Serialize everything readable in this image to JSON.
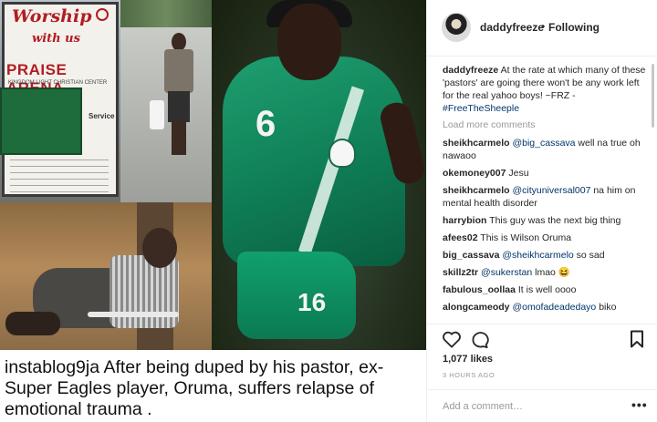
{
  "post": {
    "sign_texts": {
      "title": "Worship",
      "with": "with us",
      "name": "PRAISE ARENA",
      "sub": "KINGDOM LIGHT CHRISTIAN CENTER",
      "service": "Service"
    },
    "jersey_number": "6",
    "shorts_number": "16",
    "caption": {
      "user": "instablog9ja",
      "text": "After being duped by his pastor, ex-Super Eagles player, Oruma, suffers relapse of emotional trauma ."
    }
  },
  "header": {
    "username": "daddyfreeze",
    "separator": "•",
    "follow_status": "Following"
  },
  "post_body": {
    "username": "daddyfreeze",
    "text": "At the rate at which many of these 'pastors' are going there won't be any work left for the real yahoo boys! ~FRZ -",
    "hashtag": "#FreeTheSheeple"
  },
  "load_more": "Load more comments",
  "comments": [
    {
      "user": "sheikhcarmelo",
      "mention": "@big_cassava",
      "text": "well na true oh nawaoo"
    },
    {
      "user": "okemoney007",
      "mention": "",
      "text": "Jesu"
    },
    {
      "user": "sheikhcarmelo",
      "mention": "@cityuniversal007",
      "text": "na him on mental health disorder"
    },
    {
      "user": "harrybion",
      "mention": "",
      "text": "This guy was the next big thing"
    },
    {
      "user": "afees02",
      "mention": "",
      "text": "This is Wilson Oruma"
    },
    {
      "user": "big_cassava",
      "mention": "@sheikhcarmelo",
      "text": "so sad"
    },
    {
      "user": "skillz2tr",
      "mention": "@sukerstan",
      "text": "lmao 😆"
    },
    {
      "user": "fabulous_oollaa",
      "mention": "",
      "text": "It is well oooo"
    },
    {
      "user": "alongcameody",
      "mention": "@omofadeadedayo",
      "text": "biko"
    }
  ],
  "actions": {
    "likes": "1,077 likes",
    "time_ago": "3 HOURS AGO"
  },
  "add_comment": {
    "placeholder": "Add a comment…",
    "more": "•••"
  },
  "icons": [
    "heart-icon",
    "comment-icon",
    "bookmark-icon",
    "more-options-icon"
  ]
}
